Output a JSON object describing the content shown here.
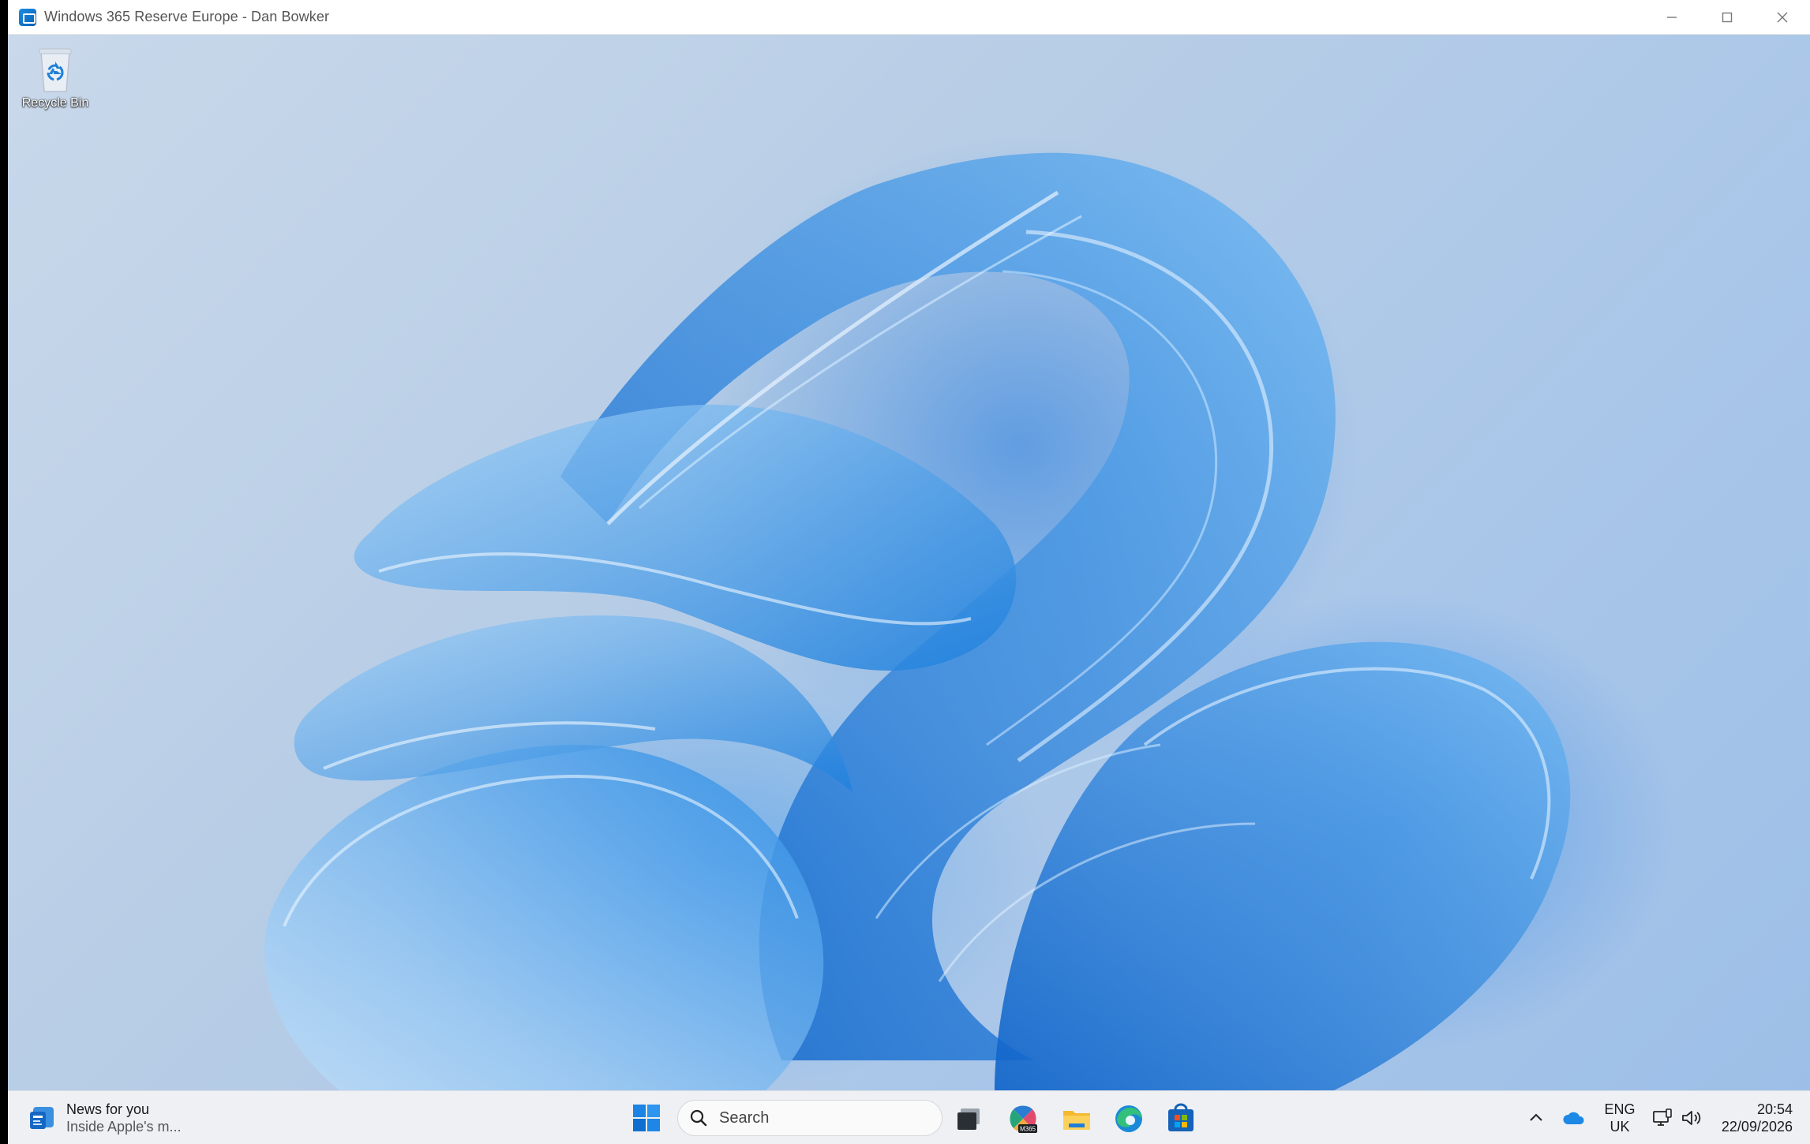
{
  "window": {
    "title": "Windows 365 Reserve Europe - Dan Bowker",
    "controls": {
      "minimize_icon": "minimize-icon",
      "maximize_icon": "maximize-icon",
      "close_icon": "close-icon"
    }
  },
  "desktop": {
    "icons": [
      {
        "label": "Recycle Bin",
        "icon": "recycle-bin-icon"
      }
    ],
    "wallpaper": "windows-11-bloom"
  },
  "taskbar": {
    "widget": {
      "title": "News for you",
      "subtitle": "Inside Apple's m...",
      "icon": "news-icon"
    },
    "search": {
      "placeholder": "Search"
    },
    "apps": [
      {
        "name": "Task View",
        "icon": "task-view-icon"
      },
      {
        "name": "Microsoft 365 Copilot",
        "icon": "m365-icon",
        "badge": "M365"
      },
      {
        "name": "File Explorer",
        "icon": "folder-icon"
      },
      {
        "name": "Microsoft Edge",
        "icon": "edge-icon"
      },
      {
        "name": "Microsoft Store",
        "icon": "store-icon"
      }
    ],
    "tray": {
      "language": {
        "line1": "ENG",
        "line2": "UK"
      },
      "time": "20:54",
      "date": "22/09/2026"
    }
  },
  "colors": {
    "accent": "#0078d4",
    "taskbar_bg": "#eef0f3",
    "titlebar_bg": "#ffffff"
  }
}
